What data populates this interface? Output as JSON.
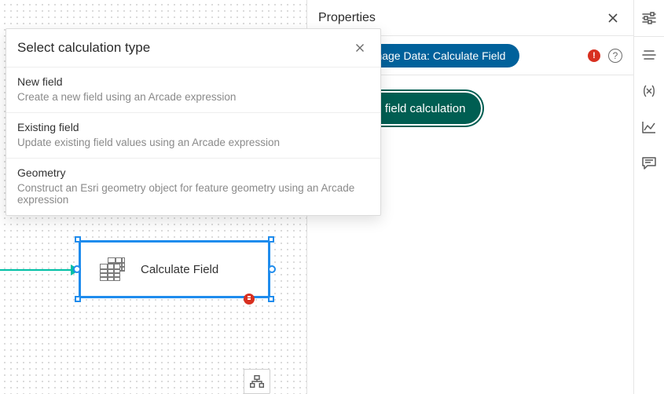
{
  "properties": {
    "title": "Properties",
    "pill": "Manage Data: Calculate Field",
    "add_button": "Add field calculation"
  },
  "canvas": {
    "node_label": "Calculate Field"
  },
  "rail": {
    "items": [
      {
        "name": "sliders-icon"
      },
      {
        "name": "settings-lines-icon"
      },
      {
        "name": "variables-icon"
      },
      {
        "name": "chart-line-icon"
      },
      {
        "name": "comment-icon"
      }
    ]
  },
  "popover": {
    "title": "Select calculation type",
    "options": [
      {
        "title": "New field",
        "desc": "Create a new field using an Arcade expression"
      },
      {
        "title": "Existing field",
        "desc": "Update existing field values using an Arcade expression"
      },
      {
        "title": "Geometry",
        "desc": "Construct an Esri geometry object for feature geometry using an Arcade expression"
      }
    ]
  }
}
